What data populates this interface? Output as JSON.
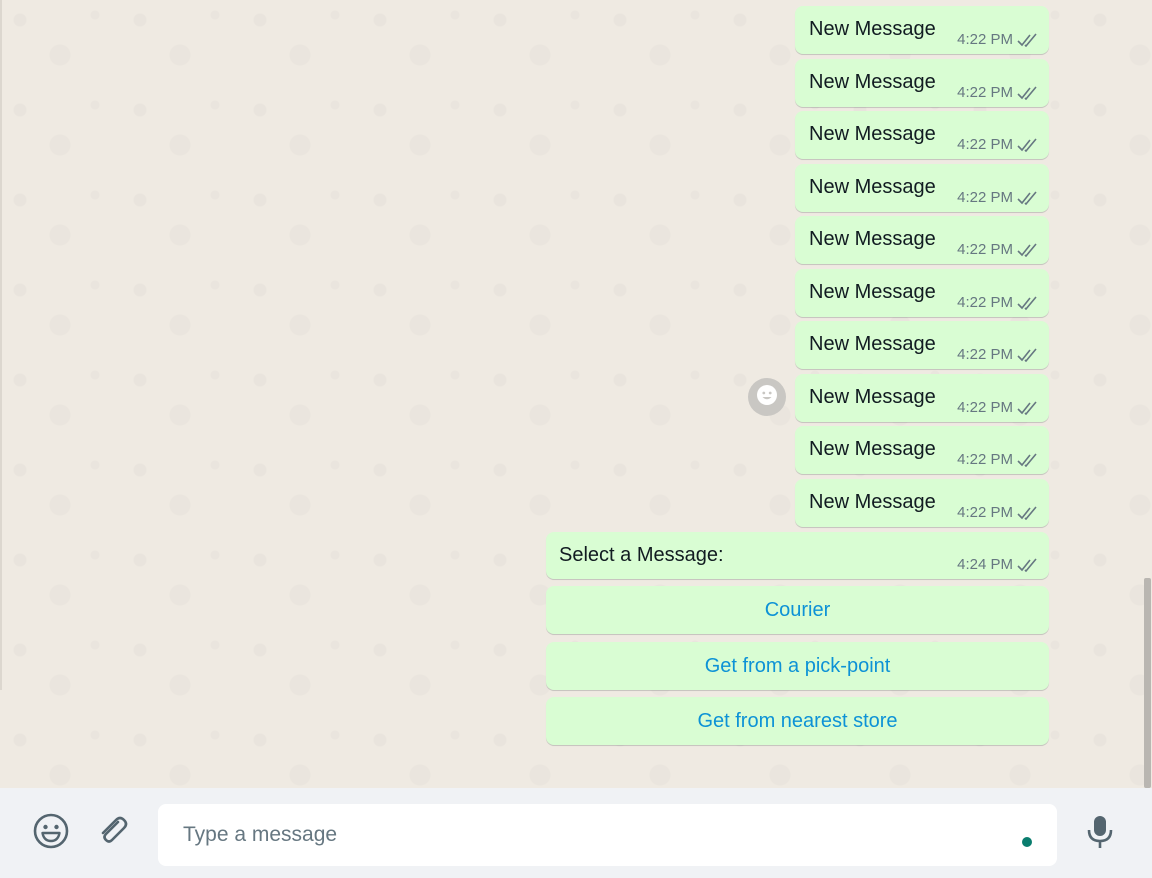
{
  "colors": {
    "outgoing_bubble": "#d9fdd3",
    "chat_background": "#efeae2",
    "footer_background": "#f0f2f5",
    "button_text": "#0d92d6",
    "typing_indicator": "#0a7d6e"
  },
  "messages": [
    {
      "text": "New Message",
      "time": "4:22 PM",
      "status": "double-check-icon"
    },
    {
      "text": "New Message",
      "time": "4:22 PM",
      "status": "double-check-icon"
    },
    {
      "text": "New Message",
      "time": "4:22 PM",
      "status": "double-check-icon"
    },
    {
      "text": "New Message",
      "time": "4:22 PM",
      "status": "double-check-icon"
    },
    {
      "text": "New Message",
      "time": "4:22 PM",
      "status": "double-check-icon"
    },
    {
      "text": "New Message",
      "time": "4:22 PM",
      "status": "double-check-icon"
    },
    {
      "text": "New Message",
      "time": "4:22 PM",
      "status": "double-check-icon"
    },
    {
      "text": "New Message",
      "time": "4:22 PM",
      "status": "double-check-icon"
    },
    {
      "text": "New Message",
      "time": "4:22 PM",
      "status": "double-check-icon"
    },
    {
      "text": "New Message",
      "time": "4:22 PM",
      "status": "double-check-icon"
    }
  ],
  "select_message": {
    "text": "Select a Message:",
    "time": "4:24 PM",
    "status": "double-check-icon"
  },
  "options": [
    {
      "label": "Courier"
    },
    {
      "label": "Get from a pick-point"
    },
    {
      "label": "Get from nearest store"
    }
  ],
  "reaction": {
    "icon": "smiley-icon"
  },
  "composer": {
    "placeholder": "Type a message",
    "emoji_icon": "emoji-icon",
    "attach_icon": "paperclip-icon",
    "mic_icon": "microphone-icon"
  }
}
